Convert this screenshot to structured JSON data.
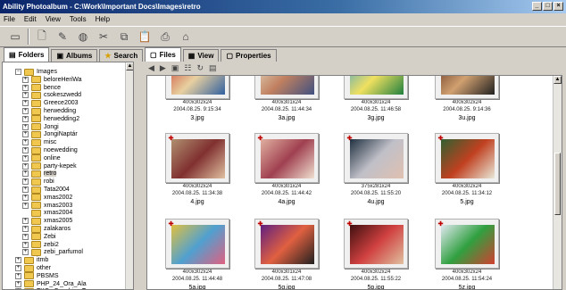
{
  "window": {
    "title": "Ability Photoalbum - C:\\Work\\Important Docs\\Images\\retro"
  },
  "menu": [
    "File",
    "Edit",
    "View",
    "Tools",
    "Help"
  ],
  "toolbar": [
    "monitor-icon",
    "new-icon",
    "edit-icon",
    "globe-icon",
    "cut-icon",
    "copy-icon",
    "paste-icon",
    "print-icon",
    "tag-icon"
  ],
  "left_tabs": [
    {
      "label": "Folders",
      "icon": "folders-icon"
    },
    {
      "label": "Albums",
      "icon": "albums-icon"
    },
    {
      "label": "Search",
      "icon": "star-icon"
    }
  ],
  "tree": [
    {
      "label": "Images",
      "expander": "−",
      "indent": 0,
      "selected": false
    },
    {
      "label": "beloreHeriWa",
      "expander": "+",
      "indent": 1
    },
    {
      "label": "bence",
      "expander": "+",
      "indent": 1
    },
    {
      "label": "csokeszwedd",
      "expander": "+",
      "indent": 1
    },
    {
      "label": "Greece2003",
      "expander": "+",
      "indent": 1
    },
    {
      "label": "herwedding",
      "expander": "+",
      "indent": 1
    },
    {
      "label": "herwedding2",
      "expander": "+",
      "indent": 1
    },
    {
      "label": "Jongi",
      "expander": "+",
      "indent": 1
    },
    {
      "label": "JongiNaptár",
      "expander": "+",
      "indent": 1
    },
    {
      "label": "misc",
      "expander": "+",
      "indent": 1
    },
    {
      "label": "noewedding",
      "expander": "+",
      "indent": 1
    },
    {
      "label": "online",
      "expander": "+",
      "indent": 1
    },
    {
      "label": "party-kepek",
      "expander": "+",
      "indent": 1
    },
    {
      "label": "retro",
      "expander": "+",
      "indent": 1,
      "selected": true
    },
    {
      "label": "robi",
      "expander": "+",
      "indent": 1
    },
    {
      "label": "Tata2004",
      "expander": "+",
      "indent": 1
    },
    {
      "label": "xmas2002",
      "expander": "+",
      "indent": 1
    },
    {
      "label": "xmas2003",
      "expander": "+",
      "indent": 1
    },
    {
      "label": "xmas2004",
      "expander": "",
      "indent": 1
    },
    {
      "label": "xmas2005",
      "expander": "+",
      "indent": 1
    },
    {
      "label": "zalakaros",
      "expander": "+",
      "indent": 1
    },
    {
      "label": "Zebi",
      "expander": "+",
      "indent": 1
    },
    {
      "label": "zebi2",
      "expander": "+",
      "indent": 1
    },
    {
      "label": "zebi_parfumol",
      "expander": "+",
      "indent": 1
    },
    {
      "label": "itmb",
      "expander": "+",
      "indent": 0
    },
    {
      "label": "other",
      "expander": "+",
      "indent": 0
    },
    {
      "label": "PBSMS",
      "expander": "+",
      "indent": 0
    },
    {
      "label": "PHP_24_Ora_Ala",
      "expander": "+",
      "indent": 0
    },
    {
      "label": "TKCs Coaching T",
      "expander": "+",
      "indent": 0
    }
  ],
  "right_tabs": [
    {
      "label": "Files",
      "icon": "files-icon"
    },
    {
      "label": "View",
      "icon": "view-icon"
    },
    {
      "label": "Properties",
      "icon": "properties-icon"
    }
  ],
  "gallery": [
    {
      "name": "3.jpg",
      "dims": "400x302x24",
      "date": "2004.08.25. 9:15:34",
      "flag": false,
      "colors": [
        "#c84030",
        "#e8d0a0",
        "#3060a0"
      ]
    },
    {
      "name": "3a.jpg",
      "dims": "400x301x24",
      "date": "2004.08.25. 11:44:34",
      "flag": false,
      "colors": [
        "#e8e0c8",
        "#c08060",
        "#405080"
      ]
    },
    {
      "name": "3g.jpg",
      "dims": "400x301x24",
      "date": "2004.08.25. 11:46:58",
      "flag": false,
      "colors": [
        "#40a0d0",
        "#f0e060",
        "#208040"
      ]
    },
    {
      "name": "3u.jpg",
      "dims": "400x302x24",
      "date": "2004.08.25. 9:14:36",
      "flag": false,
      "colors": [
        "#603020",
        "#d0a070",
        "#202020"
      ]
    },
    {
      "name": "4.jpg",
      "dims": "400x302x24",
      "date": "2004.08.25. 11:34:38",
      "flag": true,
      "colors": [
        "#b09070",
        "#803030",
        "#e0c0a0"
      ]
    },
    {
      "name": "4a.jpg",
      "dims": "400x301x24",
      "date": "2004.08.25. 11:44:42",
      "flag": true,
      "colors": [
        "#e0b0a0",
        "#a04050",
        "#f0e0d0"
      ]
    },
    {
      "name": "4u.jpg",
      "dims": "375x281x24",
      "date": "2004.08.25. 11:55:20",
      "flag": true,
      "colors": [
        "#203040",
        "#c0c0c8",
        "#e0c0b0"
      ]
    },
    {
      "name": "5.jpg",
      "dims": "400x302x24",
      "date": "2004.08.25. 11:34:12",
      "flag": true,
      "colors": [
        "#306030",
        "#c04020",
        "#e8e8d8"
      ]
    },
    {
      "name": "5a.jpg",
      "dims": "400x302x24",
      "date": "2004.08.25. 11:44:48",
      "flag": true,
      "colors": [
        "#e0c040",
        "#50a0d0",
        "#e06080"
      ]
    },
    {
      "name": "5g.jpg",
      "dims": "400x301x24",
      "date": "2004.08.25. 11:47:08",
      "flag": true,
      "colors": [
        "#602080",
        "#e06040",
        "#202020"
      ]
    },
    {
      "name": "5p.jpg",
      "dims": "400x302x24",
      "date": "2004.08.25. 11:55:22",
      "flag": true,
      "colors": [
        "#401010",
        "#d04040",
        "#e0c0a0"
      ]
    },
    {
      "name": "5z.jpg",
      "dims": "400x302x24",
      "date": "2004.08.25. 11:54:24",
      "flag": true,
      "colors": [
        "#e0e8f0",
        "#30a040",
        "#d04030"
      ]
    }
  ]
}
